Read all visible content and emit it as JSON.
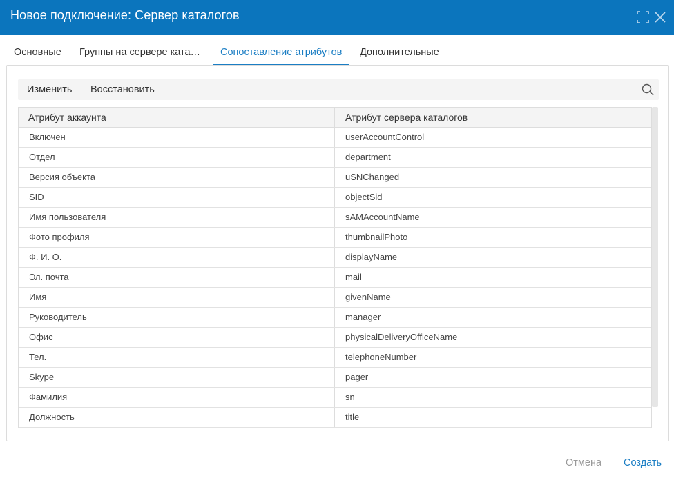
{
  "dialog": {
    "title": "Новое подключение: Сервер каталогов",
    "maximize_icon": "maximize-icon",
    "close_icon": "close-icon"
  },
  "tabs": [
    {
      "label": "Основные",
      "active": false
    },
    {
      "label": "Группы на сервере ката…",
      "active": false
    },
    {
      "label": "Сопоставление атрибутов",
      "active": true
    },
    {
      "label": "Дополнительные",
      "active": false
    }
  ],
  "toolbar": {
    "edit_label": "Изменить",
    "restore_label": "Восстановить",
    "search_icon": "search-icon"
  },
  "table": {
    "columns": [
      "Атрибут аккаунта",
      "Атрибут сервера каталогов"
    ],
    "rows": [
      [
        "Включен",
        "userAccountControl"
      ],
      [
        "Отдел",
        "department"
      ],
      [
        "Версия объекта",
        "uSNChanged"
      ],
      [
        "SID",
        "objectSid"
      ],
      [
        "Имя пользователя",
        "sAMAccountName"
      ],
      [
        "Фото профиля",
        "thumbnailPhoto"
      ],
      [
        "Ф. И. О.",
        "displayName"
      ],
      [
        "Эл. почта",
        "mail"
      ],
      [
        "Имя",
        "givenName"
      ],
      [
        "Руководитель",
        "manager"
      ],
      [
        "Офис",
        "physicalDeliveryOfficeName"
      ],
      [
        "Тел.",
        "telephoneNumber"
      ],
      [
        "Skype",
        "pager"
      ],
      [
        "Фамилия",
        "sn"
      ],
      [
        "Должность",
        "title"
      ]
    ]
  },
  "footer": {
    "cancel_label": "Отмена",
    "create_label": "Создать"
  },
  "colors": {
    "titlebar": "#0b75bd",
    "accent": "#1b7ec4",
    "muted": "#999999"
  }
}
